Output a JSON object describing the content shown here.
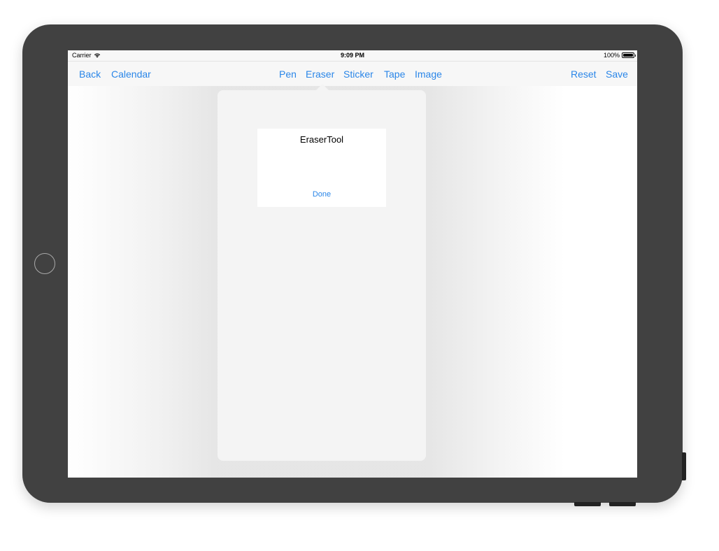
{
  "status_bar": {
    "carrier": "Carrier",
    "time": "9:09 PM",
    "battery": "100%",
    "icons": [
      "wifi-icon",
      "battery-icon"
    ]
  },
  "nav": {
    "left": {
      "back": "Back",
      "calendar": "Calendar"
    },
    "center": {
      "pen": "Pen",
      "eraser": "Eraser",
      "sticker": "Sticker",
      "tape": "Tape",
      "image": "Image"
    },
    "right": {
      "reset": "Reset",
      "save": "Save"
    }
  },
  "popover": {
    "title": "EraserTool",
    "done": "Done"
  },
  "colors": {
    "accent": "#2a86e8",
    "device": "#414141",
    "bar": "#f7f7f7",
    "popover": "#f4f4f4"
  }
}
